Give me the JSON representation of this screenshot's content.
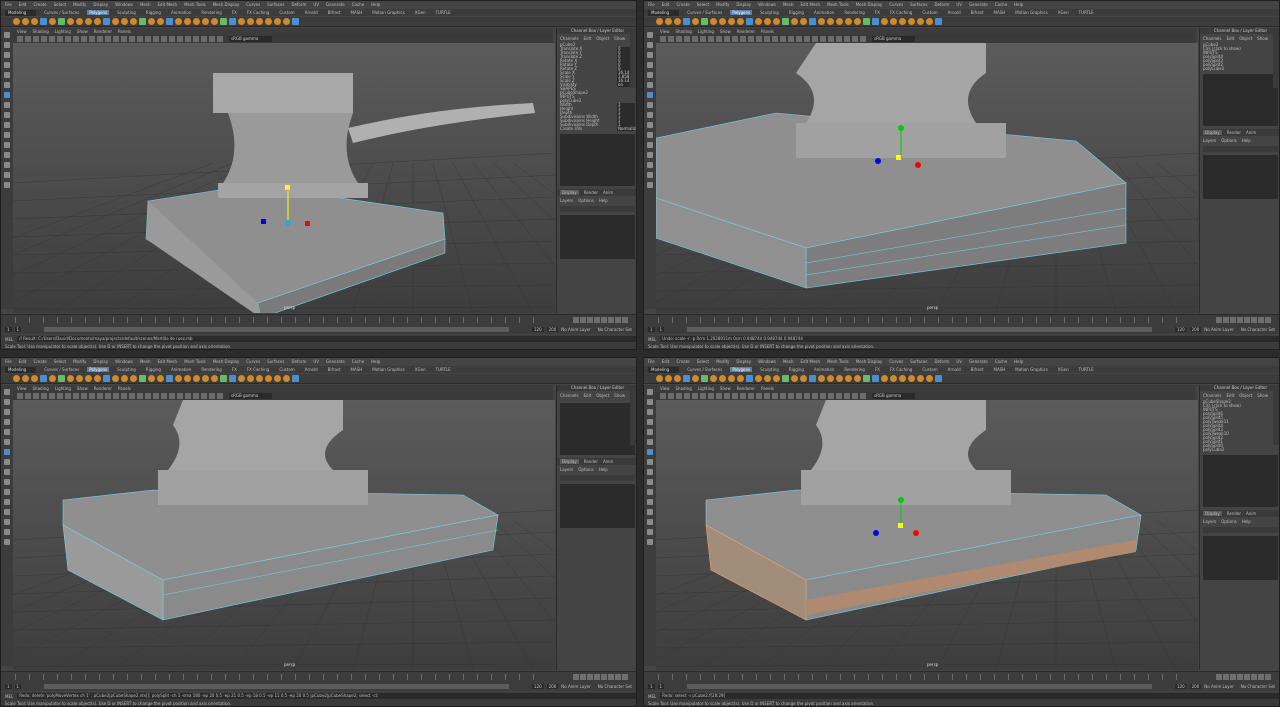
{
  "app": {
    "menus": [
      "File",
      "Edit",
      "Create",
      "Select",
      "Modify",
      "Display",
      "Windows",
      "Mesh",
      "Edit Mesh",
      "Mesh Tools",
      "Mesh Display",
      "Curves",
      "Surfaces",
      "Deform",
      "UV",
      "Generate",
      "Cache",
      "Help"
    ],
    "workspace_menu": "Modeling",
    "shelf_tabs": [
      "Curves / Surfaces",
      "Polygons",
      "Sculpting",
      "Rigging",
      "Animation",
      "Rendering",
      "FX",
      "FX Caching",
      "Custom",
      "Arnold",
      "Bifrost",
      "MASH",
      "Motion Graphics",
      "XGen",
      "TURTLE"
    ],
    "active_shelf_tab": "Polygons",
    "live_surface": "No Live Surface",
    "panel_menus": [
      "View",
      "Shading",
      "Lighting",
      "Show",
      "Renderer",
      "Panels"
    ],
    "viewport_label": "persp",
    "gamma": "sRGB gamma",
    "channel_box": {
      "title": "Channel Box / Layer Editor",
      "tabs": [
        "Channels",
        "Edit",
        "Object",
        "Show"
      ],
      "display_tabs": [
        "Display",
        "Render",
        "Anim"
      ],
      "layer_menus": [
        "Layers",
        "Options",
        "Help"
      ]
    },
    "timeline": {
      "start": "1",
      "end": "120",
      "current": "1"
    },
    "range": {
      "start": "1",
      "inner_start": "1",
      "inner_end": "120",
      "end": "120",
      "anim_end": "200"
    },
    "no_anim_layer": "No Anim Layer",
    "no_char_set": "No Character Set",
    "mel_label": "MEL",
    "accent": "#5d7fa6",
    "edge_highlight": "#6fd3ea"
  },
  "panes": [
    {
      "id": "top-left",
      "channel_object": "pCube2",
      "attributes": [
        {
          "name": "Translate X",
          "value": "0"
        },
        {
          "name": "Translate Y",
          "value": "0"
        },
        {
          "name": "Translate Z",
          "value": "0"
        },
        {
          "name": "Rotate X",
          "value": "0"
        },
        {
          "name": "Rotate Y",
          "value": "0"
        },
        {
          "name": "Rotate Z",
          "value": "0"
        },
        {
          "name": "Scale X",
          "value": "16.141"
        },
        {
          "name": "Scale Y",
          "value": "1.858"
        },
        {
          "name": "Scale Z",
          "value": "16.141"
        },
        {
          "name": "Visibility",
          "value": "on"
        }
      ],
      "shapes_header": "SHAPES",
      "shape": "pCubeShape2",
      "inputs_header": "INPUTS",
      "inputs": [
        "polyCube2"
      ],
      "input_attrs": [
        "Width",
        "Height",
        "Depth",
        "Subdivisions Width",
        "Subdivisions Height",
        "Subdivisions Depth",
        "Create UVs"
      ],
      "input_values": [
        "1",
        "1",
        "1",
        "1",
        "1",
        "1",
        "Normalize..."
      ],
      "result": "// Result: C:/Users/David/Documents/maya/projects/default/scenes/Martillo de ruez.mb",
      "help": "Scale Tool: Use manipulator to scale object(s). Use D or INSERT to change the pivot position and axis orientation."
    },
    {
      "id": "top-right",
      "channel_object": "pCube2",
      "lines": [
        "CVs (click to show)"
      ],
      "inputs_header": "INPUTS",
      "inputs": [
        "polySplit4",
        "polySplit3",
        "polySplit2",
        "polyCube2"
      ],
      "result": "Undo: scale -r -p 0cm 1.2028911m 0cm 0.948744 0.948744 0.948744",
      "help": "Scale Tool: Use manipulator to scale object(s). Use D or INSERT to change the pivot position and axis orientation."
    },
    {
      "id": "bottom-left",
      "result": "Redo: delete 'polyMoveVertex ch 1' ; pCube2|pCubeShape2.vtx[]; polySplit -ch 1 -sma 180 -ep 20 0.5 -ep 21 0.5 -ep 18 0.5 -ep 11 0.5 -ep 20 0.5 |pCube2|pCubeShape2; select -cl;",
      "help": "Scale Tool: Use manipulator to scale object(s). Use D or INSERT to change the pivot position and axis orientation."
    },
    {
      "id": "bottom-right",
      "channel_object": "pCubeShape2",
      "lines": [
        "CVs (click to show)"
      ],
      "inputs_header": "INPUTS",
      "inputs": [
        "polySplit6",
        "polySplit5",
        "polyTweak11",
        "polySplit4",
        "polySplit3",
        "polyTweak10",
        "polySplit2",
        "polySplit1",
        "polySplit0",
        "polyCube2"
      ],
      "result": "Redo: select -r pCube2.f[28:29]",
      "help": "Scale Tool: Use manipulator to scale object(s). Use D or INSERT to change the pivot position and axis orientation."
    }
  ]
}
